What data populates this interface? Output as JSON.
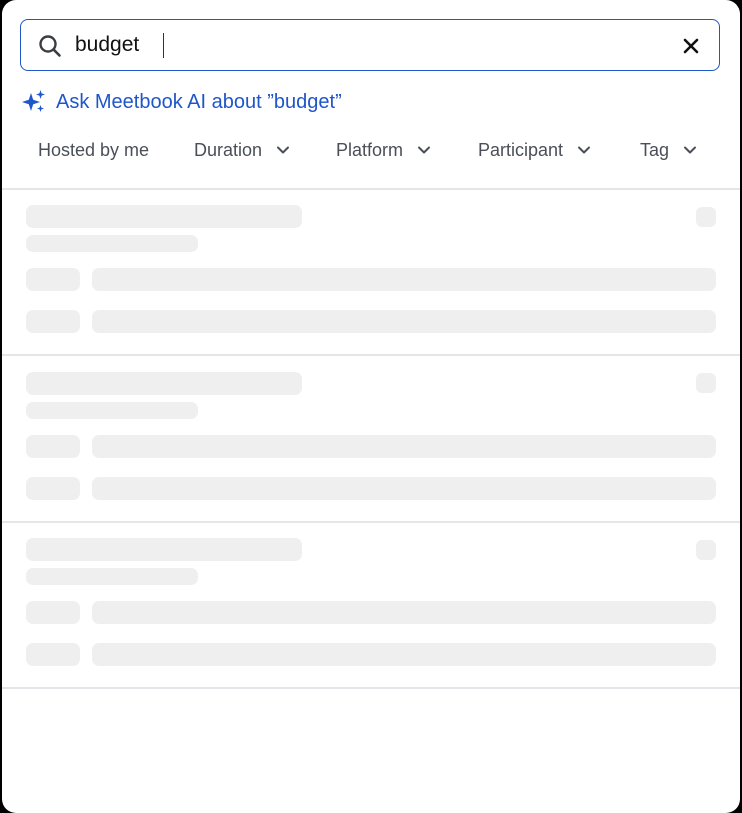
{
  "search": {
    "value": "budget",
    "placeholder": ""
  },
  "ask_ai": {
    "label": "Ask Meetbook AI about ”budget”"
  },
  "filters": [
    {
      "label": "Hosted by me",
      "has_dropdown": false
    },
    {
      "label": "Duration",
      "has_dropdown": true
    },
    {
      "label": "Platform",
      "has_dropdown": true
    },
    {
      "label": "Participant",
      "has_dropdown": true
    },
    {
      "label": "Tag",
      "has_dropdown": true
    }
  ],
  "results": {
    "state": "loading",
    "placeholder_count": 3
  },
  "colors": {
    "accent": "#1f56c9",
    "skeleton": "#efefef",
    "divider": "#e4e6e9",
    "filter_text": "#4a4f57"
  },
  "icons": {
    "search": "search-icon",
    "clear": "close-icon",
    "ai": "sparkle-icon",
    "dropdown": "chevron-down-icon"
  }
}
